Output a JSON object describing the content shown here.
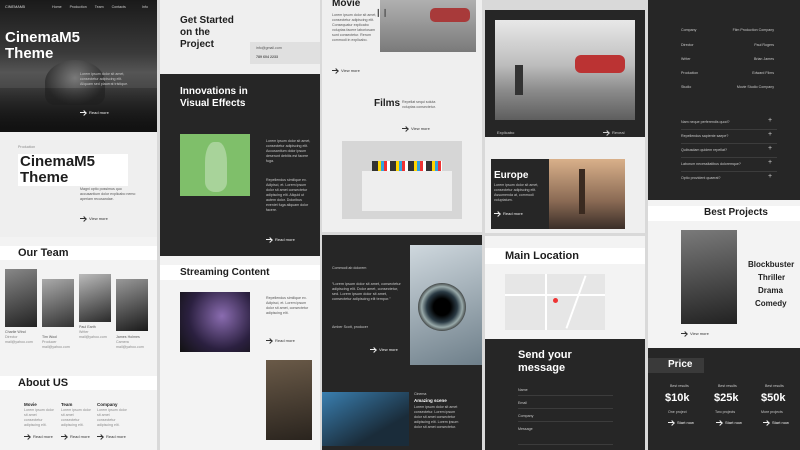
{
  "nav": {
    "brand": "CINEMAM5",
    "items": [
      "Home",
      "Production",
      "Team",
      "Contacts"
    ],
    "right": "Info"
  },
  "hero": {
    "title": "CinemaM5 Theme",
    "text": "Lorem ipsum dolor sit amet, consectetur adipiscing elit. Aliquam sed placerat tristique.",
    "button": "Read more"
  },
  "intro": {
    "tag": "Production",
    "title": "CinemaM5 Theme",
    "text": "Magni optio possimus quo accusantium dolor explicabo nemo aperiam recusandae.",
    "button": "View more"
  },
  "team": {
    "title": "Our Team",
    "members": [
      {
        "name": "Charlie Wind",
        "role": "Director",
        "mail": "mail@yahoo.com"
      },
      {
        "name": "Tim Wool",
        "role": "Producer",
        "mail": "mail@yahoo.com"
      },
      {
        "name": "Paul Earth",
        "role": "Writer",
        "mail": "mail@yahoo.com"
      },
      {
        "name": "James Holmes",
        "role": "Camera",
        "mail": "mail@yahoo.com"
      }
    ]
  },
  "about": {
    "title": "About US",
    "cols": [
      {
        "h": "Movie",
        "t": "Lorem ipsum dolor sit amet consectetur adipiscing elit.",
        "b": "Read more"
      },
      {
        "h": "Team",
        "t": "Lorem ipsum dolor sit amet consectetur adipiscing elit.",
        "b": "Read more"
      },
      {
        "h": "Company",
        "t": "Lorem ipsum dolor sit amet consectetur adipiscing elit.",
        "b": "Read more"
      }
    ]
  },
  "started": {
    "title": "Get Started on the Project",
    "mail": "info@gmail.com",
    "phone": "789 604 2233"
  },
  "vfx": {
    "title": "Innovations in Visual Effects",
    "text1": "Lorem ipsum dolor sit amet, consectetur adipiscing elit. Accusantium dolor ipsum deserunt debitis est facere fuga.",
    "text2": "Repellendus similique ex. Adipisci, et. Lorem ipsum dolor sit amet consectetur adipiscing elit. Aliquid ut autem dolor. Doloribus eveniet fuga aliquam dolor facere.",
    "button": "Read more"
  },
  "streaming": {
    "title": "Streaming Content",
    "text": "Repellendus similique ex. Adipisci, et. Lorem ipsum dolor sit amet, consectetur adipiscing elit.",
    "button": "Read more"
  },
  "movie": {
    "title": "Movie",
    "text": "Lorem ipsum dolor sit amet, consectetur adipiscing elit. Consequatur explicabo voluptas facere laboriosam sunt consectetur. Rerum commodi in explicabo.",
    "button": "View more"
  },
  "films": {
    "title": "Films",
    "text": "Repellat sequi soluta voluptas consectetur.",
    "button": "View more"
  },
  "quote": {
    "tag": "Commodi ab dolorem",
    "text": "“Lorem ipsum dolor sit amet, consectetur adipiscing elit. Dolor amet, consectetur, sed. Lorem ipsum dolor sit amet, consectetur adipiscing elit tempor.”",
    "author": "Amber Scott, producer",
    "button": "View more"
  },
  "amazing": {
    "tag": "Cinema",
    "title": "Amazing scene",
    "text": "Lorem ipsum dolor sit amet consectetur. Lorem ipsum dolor sit amet consectetur adipiscing elit. Lorem ipsum dolor sit amet consectetur."
  },
  "slider": {
    "left": "Explicabo",
    "right": "Reveal"
  },
  "europe": {
    "title": "Europe",
    "text": "Lorem ipsum dolor sit amet, consectetur adipiscing elit. Assumenda at, commodi voluptatum.",
    "button": "Read more"
  },
  "location": {
    "title": "Main Location"
  },
  "message": {
    "title": "Send your message",
    "fields": [
      "Name",
      "Email",
      "Company",
      "Message"
    ]
  },
  "credits": [
    {
      "k": "Company",
      "v": "Film Production Company"
    },
    {
      "k": "Director",
      "v": "Paul Rogers"
    },
    {
      "k": "Writer",
      "v": "Brian James"
    },
    {
      "k": "Production",
      "v": "Edward Films"
    },
    {
      "k": "Studio",
      "v": "Movie Studio Company"
    }
  ],
  "faq": [
    "Nam neque perferendis quod?",
    "Repellendus sapiente saepe?",
    "Quibusdam quidem repellat?",
    "Laborum necessitatibus doloremque?",
    "Optio provident quaerat?"
  ],
  "projects": {
    "title": "Best Projects",
    "items": [
      "Blockbuster",
      "Thriller",
      "Drama",
      "Comedy"
    ],
    "button": "View more"
  },
  "price": {
    "title": "Price",
    "tiers": [
      {
        "label": "Best results",
        "value": "$10k",
        "name": "One project",
        "button": "Start now"
      },
      {
        "label": "Best results",
        "value": "$25k",
        "name": "Two projects",
        "button": "Start now"
      },
      {
        "label": "Best results",
        "value": "$50k",
        "name": "More projects",
        "button": "Start now"
      }
    ]
  },
  "colors": {
    "dark": "#262626",
    "light": "#efefef"
  }
}
